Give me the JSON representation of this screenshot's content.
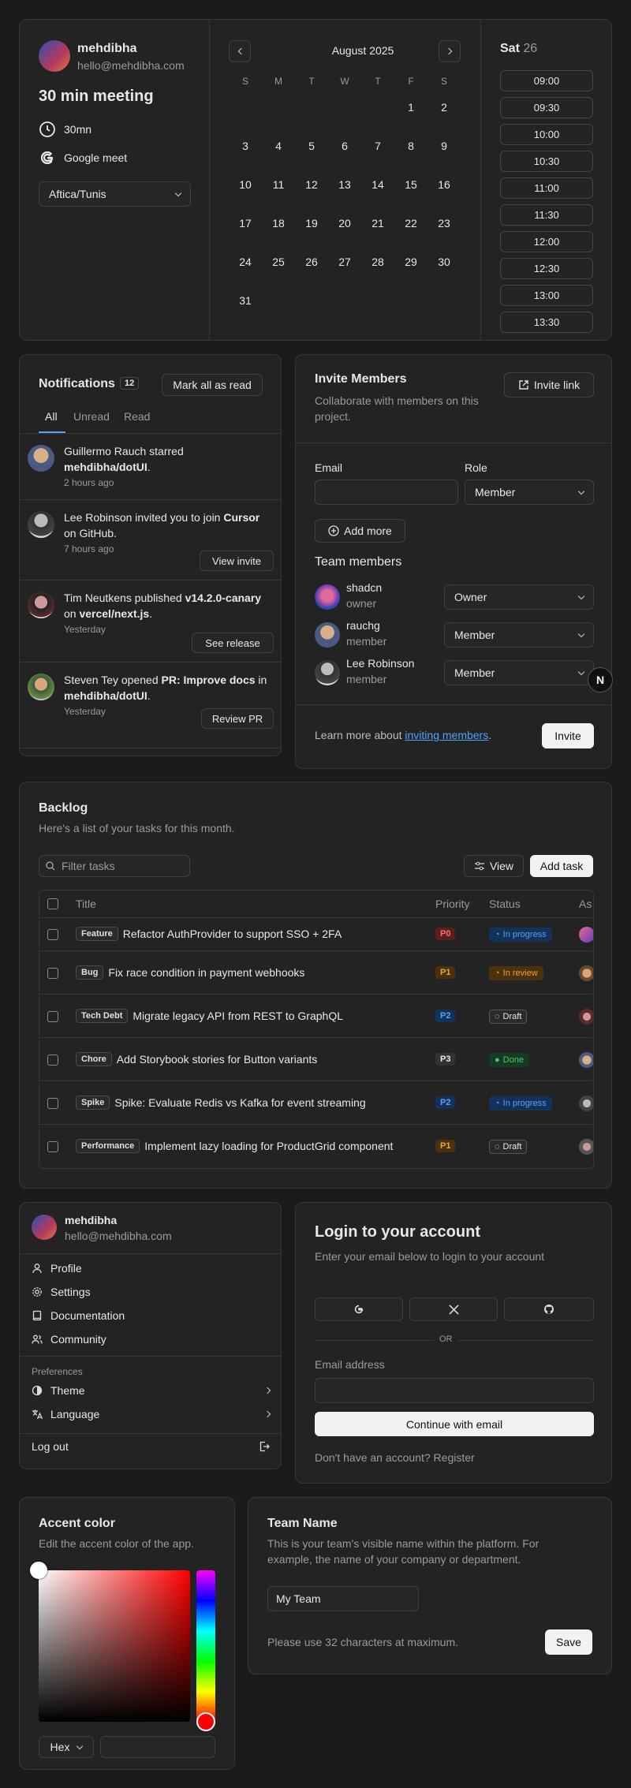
{
  "booking": {
    "user_name": "mehdibha",
    "user_email": "hello@mehdibha.com",
    "meeting_title": "30 min meeting",
    "duration": "30mn",
    "platform": "Google meet",
    "timezone": "Aftica/Tunis",
    "month": "August 2025",
    "weekdays": [
      "S",
      "M",
      "T",
      "W",
      "T",
      "F",
      "S"
    ],
    "days": [
      "",
      "",
      "",
      "",
      "",
      "1",
      "2",
      "3",
      "4",
      "5",
      "6",
      "7",
      "8",
      "9",
      "10",
      "11",
      "12",
      "13",
      "14",
      "15",
      "16",
      "17",
      "18",
      "19",
      "20",
      "21",
      "22",
      "23",
      "24",
      "25",
      "26",
      "27",
      "28",
      "29",
      "30",
      "31"
    ],
    "selected_day_name": "Sat",
    "selected_day_num": "26",
    "slots": [
      "09:00",
      "09:30",
      "10:00",
      "10:30",
      "11:00",
      "11:30",
      "12:00",
      "12:30",
      "13:00",
      "13:30"
    ]
  },
  "notifications": {
    "title": "Notifications",
    "count": "12",
    "mark_all": "Mark all as read",
    "tabs": [
      "All",
      "Unread",
      "Read"
    ],
    "items": [
      {
        "pre": "Guillermo Rauch starred ",
        "bold": "mehdibha/dotUI",
        "post": ".",
        "bold2": "",
        "post2": "",
        "time": "2 hours ago",
        "action": ""
      },
      {
        "pre": "Lee Robinson invited you to join ",
        "bold": "Cursor",
        "post": " on GitHub.",
        "bold2": "",
        "post2": "",
        "time": "7 hours ago",
        "action": "View invite"
      },
      {
        "pre": "Tim Neutkens published ",
        "bold": "v14.2.0-canary",
        "post": " on ",
        "bold2": "vercel/next.js",
        "post2": ".",
        "time": "Yesterday",
        "action": "See release"
      },
      {
        "pre": "Steven Tey opened ",
        "bold": "PR: Improve docs",
        "post": " in ",
        "bold2": "mehdibha/dotUI",
        "post2": ".",
        "time": "Yesterday",
        "action": "Review PR"
      }
    ]
  },
  "invite": {
    "title": "Invite Members",
    "subtitle": "Collaborate with members on this project.",
    "invite_link": "Invite link",
    "email_label": "Email",
    "role_label": "Role",
    "role_value": "Member",
    "add_more": "Add more",
    "team_title": "Team members",
    "members": [
      {
        "name": "shadcn",
        "role": "owner",
        "select": "Owner"
      },
      {
        "name": "rauchg",
        "role": "member",
        "select": "Member"
      },
      {
        "name": "Lee Robinson",
        "role": "member",
        "select": "Member"
      }
    ],
    "footer_text": "Learn more about ",
    "footer_link": "inviting members",
    "footer_end": ".",
    "invite_button": "Invite",
    "badge": "N"
  },
  "backlog": {
    "title": "Backlog",
    "subtitle": "Here's a list of your tasks for this month.",
    "filter_placeholder": "Filter tasks",
    "view": "View",
    "add_task": "Add task",
    "columns": [
      "Title",
      "Priority",
      "Status",
      "As"
    ],
    "rows": [
      {
        "tag": "Feature",
        "title": "Refactor AuthProvider to support SSO + 2FA",
        "priority": "P0",
        "status": "In progress"
      },
      {
        "tag": "Bug",
        "title": "Fix race condition in payment webhooks",
        "priority": "P1",
        "status": "In review"
      },
      {
        "tag": "Tech Debt",
        "title": "Migrate legacy API from REST to GraphQL",
        "priority": "P2",
        "status": "Draft"
      },
      {
        "tag": "Chore",
        "title": "Add Storybook stories for Button variants",
        "priority": "P3",
        "status": "Done"
      },
      {
        "tag": "Spike",
        "title": "Spike: Evaluate Redis vs Kafka for event streaming",
        "priority": "P2",
        "status": "In progress"
      },
      {
        "tag": "Performance",
        "title": "Implement lazy loading for ProductGrid component",
        "priority": "P1",
        "status": "Draft"
      }
    ]
  },
  "account_menu": {
    "user_name": "mehdibha",
    "user_email": "hello@mehdibha.com",
    "items": [
      "Profile",
      "Settings",
      "Documentation",
      "Community"
    ],
    "prefs_label": "Preferences",
    "theme": "Theme",
    "language": "Language",
    "logout": "Log out"
  },
  "login": {
    "title": "Login to your account",
    "subtitle": "Enter your email below to login to your account",
    "or": "OR",
    "email_label": "Email address",
    "continue": "Continue with email",
    "no_account": "Don't have an account? Register"
  },
  "accent": {
    "title": "Accent color",
    "subtitle": "Edit the accent color of the app.",
    "format": "Hex",
    "hex_value": ""
  },
  "team_name": {
    "title": "Team Name",
    "description": "This is your team's visible name within the platform. For example, the name of your company or department.",
    "value": "My Team",
    "hint": "Please use 32 characters at maximum.",
    "save": "Save"
  },
  "colors": {
    "bg": "#1b1b1b",
    "card": "#232323",
    "border": "#363636",
    "link": "#4ea3ff",
    "accent_red": "#ff0000"
  }
}
